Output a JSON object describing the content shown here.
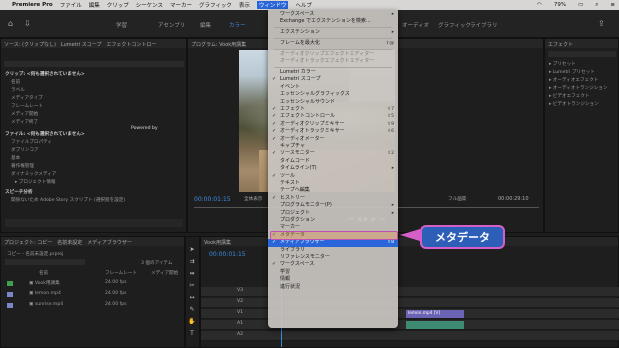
{
  "menubar": {
    "app": "Premiere Pro",
    "items": [
      "ファイル",
      "編集",
      "クリップ",
      "シーケンス",
      "マーカー",
      "グラフィック",
      "表示",
      "ウィンドウ",
      "ヘルプ"
    ],
    "battery": "79%"
  },
  "workspace": {
    "tabs": [
      "学習",
      "アセンブリ",
      "編集",
      "カラー",
      "エフェクト",
      "オーディオ",
      "グラフィック",
      "ライブラリ"
    ],
    "active": 3
  },
  "source_panel": {
    "tabs": "ソース: (クリップなし)　Lumetri スコープ　エフェクトコントロー",
    "clip_header": "クリップ: <何も選択されていません>",
    "clip_fields": [
      "名前",
      "ラベル",
      "メディアタイプ",
      "フレームレート",
      "メディア開始",
      "メディア終了"
    ],
    "file_header": "ファイル: <何も選択されていません>",
    "file_fields": [
      "ファイルプロパティ",
      "ダブリンコア",
      "基本",
      "著作権管理",
      "ダイナミックメディア"
    ],
    "file_sub": "▸ プロジェクト情報",
    "speech_header": "スピーチ分析",
    "speech_text": "関係ないため Adobe Story スクリプト (選択肢を設定)",
    "powered": "Powered by"
  },
  "program": {
    "title": "プログラム: Vook用講集",
    "timecode": "00:00:01:15",
    "fit": "全体表示",
    "quality": "フル画質",
    "end_timecode": "00:00:29:10"
  },
  "effects": {
    "title": "エフェクト",
    "items": [
      "プリセット",
      "Lumetri プリセット",
      "オーディオエフェクト",
      "オーディオトランジション",
      "ビデオエフェクト",
      "ビデオトランジション"
    ]
  },
  "project": {
    "tabs": "プロジェクト: コピー　名前未設定　メディアブラウザー",
    "path": "コピー - 名前未設定.prproj",
    "count": "3 個のアイテム",
    "col_name": "名前",
    "col_fps": "フレームレート",
    "col_media": "メディア開始",
    "rows": [
      {
        "name": "Vook用講集",
        "fps": "24.00 fps",
        "color": "#3f9f4c"
      },
      {
        "name": "lemon.mp4",
        "fps": "24.00 fps",
        "color": "#7a86c8"
      },
      {
        "name": "sunrise.mp4",
        "fps": "24.00 fps",
        "color": "#7a86c8"
      }
    ]
  },
  "timeline": {
    "title": "Vook用講集",
    "timecode": "00:00:01:15",
    "tracks": [
      "V3",
      "V2",
      "V1",
      "A1",
      "A2"
    ],
    "clip1": "lemon.mp4 [V]"
  },
  "menu": {
    "items": [
      {
        "label": "ワークスペース",
        "shortcut": "▸",
        "check": "",
        "disabled": false
      },
      {
        "label": "Exchange でエクステンションを検索...",
        "shortcut": "",
        "check": "",
        "disabled": false
      },
      {
        "sep": true
      },
      {
        "label": "エクステンション",
        "shortcut": "▸",
        "check": "",
        "disabled": false
      },
      {
        "sep": true
      },
      {
        "label": "フレームを最大化",
        "shortcut": "⇧@",
        "check": "",
        "disabled": false
      },
      {
        "sep": true
      },
      {
        "label": "オーディオクリップエフェクトエディター",
        "shortcut": "",
        "check": "",
        "disabled": true
      },
      {
        "label": "オーディオトラックエフェクトエディター",
        "shortcut": "",
        "check": "",
        "disabled": true
      },
      {
        "sep": true
      },
      {
        "label": "Lumetri カラー",
        "shortcut": "",
        "check": "",
        "disabled": false
      },
      {
        "label": "Lumetri スコープ",
        "shortcut": "",
        "check": "✓",
        "disabled": false
      },
      {
        "label": "イベント",
        "shortcut": "",
        "check": "",
        "disabled": false
      },
      {
        "label": "エッセンシャルグラフィックス",
        "shortcut": "",
        "check": "",
        "disabled": false
      },
      {
        "label": "エッセンシャルサウンド",
        "shortcut": "",
        "check": "",
        "disabled": false
      },
      {
        "label": "エフェクト",
        "shortcut": "⇧7",
        "check": "✓",
        "disabled": false
      },
      {
        "label": "エフェクトコントロール",
        "shortcut": "⇧5",
        "check": "✓",
        "disabled": false
      },
      {
        "label": "オーディオクリップミキサー",
        "shortcut": "⇧9",
        "check": "✓",
        "disabled": false
      },
      {
        "label": "オーディオトラックミキサー",
        "shortcut": "⇧6",
        "check": "✓",
        "disabled": false
      },
      {
        "label": "オーディオメーター",
        "shortcut": "",
        "check": "✓",
        "disabled": false
      },
      {
        "label": "キャプチャ",
        "shortcut": "",
        "check": "",
        "disabled": false
      },
      {
        "label": "ソースモニター",
        "shortcut": "⇧2",
        "check": "✓",
        "disabled": false
      },
      {
        "label": "タイムコード",
        "shortcut": "",
        "check": "",
        "disabled": false
      },
      {
        "label": "タイムライン(T)",
        "shortcut": "▸",
        "check": "",
        "disabled": false
      },
      {
        "label": "ツール",
        "shortcut": "",
        "check": "✓",
        "disabled": false
      },
      {
        "label": "テキスト",
        "shortcut": "",
        "check": "",
        "disabled": false
      },
      {
        "label": "テープへ編集",
        "shortcut": "",
        "check": "",
        "disabled": false
      },
      {
        "label": "ヒストリー",
        "shortcut": "",
        "check": "✓",
        "disabled": false
      },
      {
        "label": "プログラムモニター(P)",
        "shortcut": "▸",
        "check": "",
        "disabled": false
      },
      {
        "label": "プロジェクト",
        "shortcut": "▸",
        "check": "",
        "disabled": false
      },
      {
        "label": "プロダクション",
        "shortcut": "",
        "check": "",
        "disabled": false
      },
      {
        "label": "マーカー",
        "shortcut": "",
        "check": "",
        "disabled": false
      },
      {
        "label": "メタデータ",
        "shortcut": "",
        "check": "✓",
        "disabled": false,
        "highlight": true
      },
      {
        "label": "メディアブラウザー",
        "shortcut": "⇧8",
        "check": "✓",
        "disabled": false,
        "selected": true
      },
      {
        "label": "ライブラリ",
        "shortcut": "",
        "check": "",
        "disabled": false
      },
      {
        "label": "リファレンスモニター",
        "shortcut": "",
        "check": "",
        "disabled": false
      },
      {
        "label": "ワークスペース",
        "shortcut": "",
        "check": "✓",
        "disabled": false
      },
      {
        "label": "学習",
        "shortcut": "",
        "check": "",
        "disabled": false
      },
      {
        "label": "情報",
        "shortcut": "",
        "check": "",
        "disabled": false
      },
      {
        "label": "進行状況",
        "shortcut": "",
        "check": "",
        "disabled": false
      }
    ]
  },
  "callout": {
    "label": "メタデータ"
  },
  "colors": {
    "accent": "#2a66d9",
    "callout_bg": "#2d5eb8",
    "callout_border": "#d45fc8"
  }
}
